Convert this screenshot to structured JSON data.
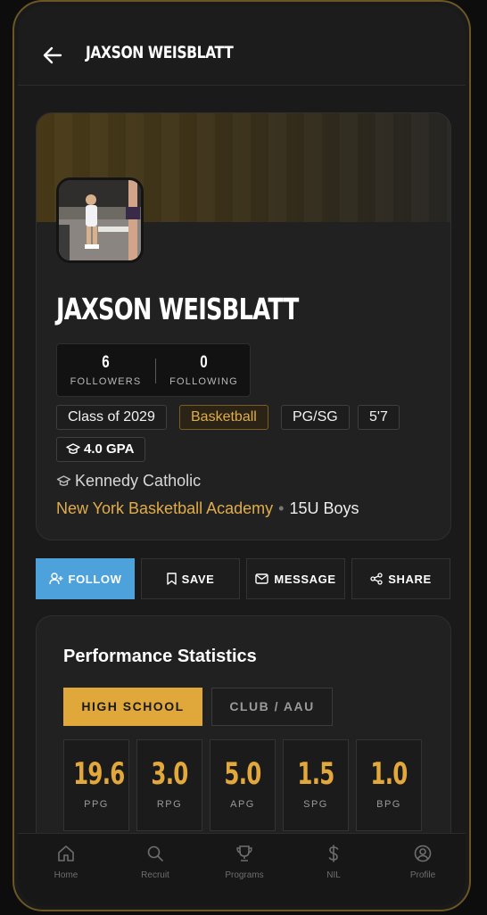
{
  "header": {
    "title": "JAXSON WEISBLATT"
  },
  "profile": {
    "name": "JAXSON WEISBLATT",
    "followers": {
      "count": "6",
      "label": "FOLLOWERS"
    },
    "following": {
      "count": "0",
      "label": "FOLLOWING"
    },
    "tags": [
      "Class of 2029",
      "Basketball",
      "PG/SG",
      "5'7"
    ],
    "gpa": "4.0 GPA",
    "school": "Kennedy Catholic",
    "team": "New York Basketball Academy",
    "team_separator": "•",
    "division": "15U Boys"
  },
  "actions": {
    "follow": "FOLLOW",
    "save": "SAVE",
    "message": "MESSAGE",
    "share": "SHARE"
  },
  "stats": {
    "title": "Performance Statistics",
    "tabs": [
      "HIGH SCHOOL",
      "CLUB / AAU"
    ],
    "active_tab": "HIGH SCHOOL",
    "items": [
      {
        "value": "19.6",
        "label": "PPG"
      },
      {
        "value": "3.0",
        "label": "RPG"
      },
      {
        "value": "5.0",
        "label": "APG"
      },
      {
        "value": "1.5",
        "label": "SPG"
      },
      {
        "value": "1.0",
        "label": "BPG"
      }
    ]
  },
  "nav": {
    "items": [
      {
        "label": "Home",
        "icon": "home-icon"
      },
      {
        "label": "Recruit",
        "icon": "search-icon"
      },
      {
        "label": "Programs",
        "icon": "trophy-icon"
      },
      {
        "label": "NIL",
        "icon": "dollar-icon"
      },
      {
        "label": "Profile",
        "icon": "user-circle-icon"
      }
    ]
  },
  "colors": {
    "accent": "#e0a83a",
    "primary_button": "#4da2dc",
    "background": "#1a1a1a"
  }
}
